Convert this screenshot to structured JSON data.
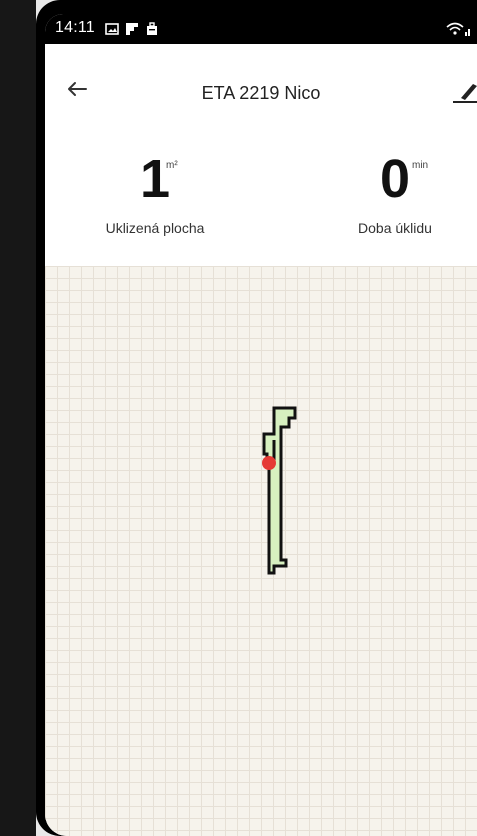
{
  "status_bar": {
    "time": "14:11",
    "notification_icons": [
      "image-icon",
      "flipboard-icon",
      "briefcase-icon"
    ],
    "right_icons": [
      "wifi-icon",
      "signal-icon"
    ]
  },
  "app_bar": {
    "title": "ETA 2219 Nico",
    "back_icon": "arrow-left-icon",
    "edit_icon": "edit-pen-icon"
  },
  "stats": {
    "area": {
      "value": "1",
      "unit": "m²",
      "label": "Uklizená plocha"
    },
    "time": {
      "value": "0",
      "unit": "min",
      "label": "Doba úklidu"
    }
  },
  "map": {
    "cleaned_area_color": "#d7f0c0",
    "wall_color": "#111111",
    "robot_color": "#e53935"
  },
  "colors": {
    "map_background": "#f6f3ec",
    "grid_line": "#e6e0d6"
  }
}
